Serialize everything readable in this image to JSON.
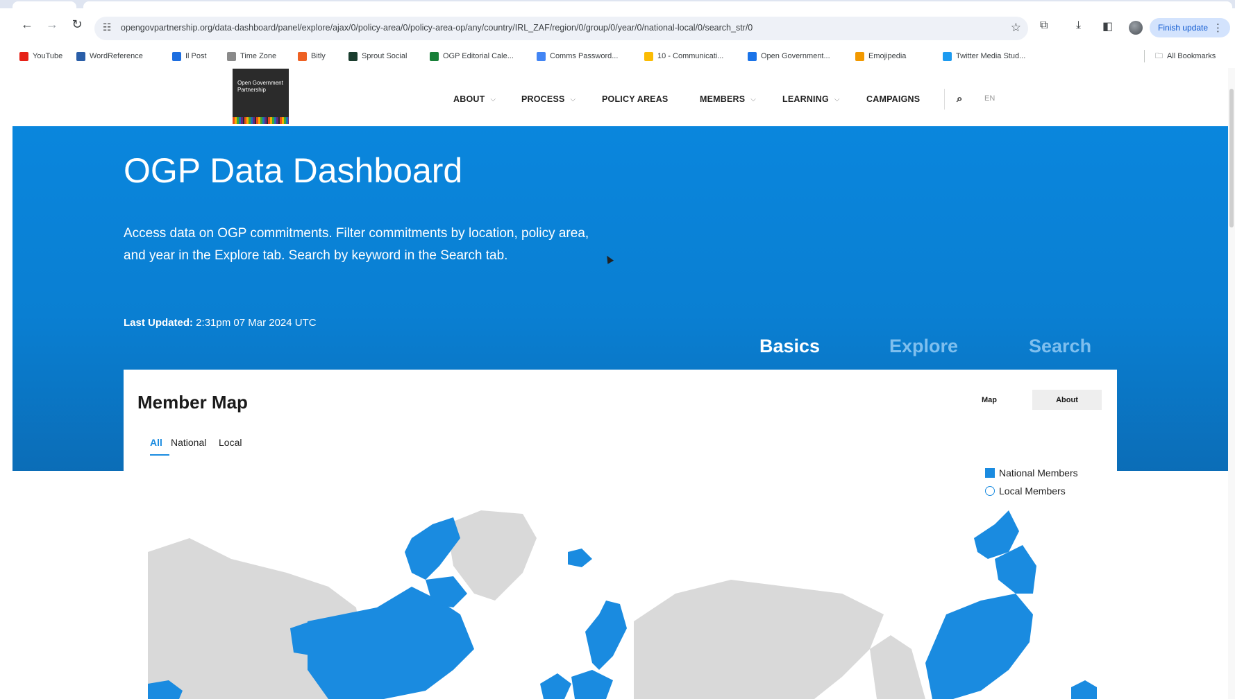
{
  "browser": {
    "url": "opengovpartnership.org/data-dashboard/panel/explore/ajax/0/policy-area/0/policy-area-op/any/country/IRL_ZAF/region/0/group/0/year/0/national-local/0/search_str/0",
    "finish_update_label": "Finish update",
    "bookmarks": [
      {
        "label": "YouTube",
        "color": "#e62117"
      },
      {
        "label": "WordReference",
        "color": "#2a5ea8"
      },
      {
        "label": "Il Post",
        "color": "#1d6ee0"
      },
      {
        "label": "Time Zone",
        "color": "#8a8a8a"
      },
      {
        "label": "Bitly",
        "color": "#ee6123"
      },
      {
        "label": "Sprout Social",
        "color": "#1a3d2e"
      },
      {
        "label": "OGP Editorial Cale...",
        "color": "#188038"
      },
      {
        "label": "Comms Password...",
        "color": "#4285f4"
      },
      {
        "label": "10 - Communicati...",
        "color": "#fbbc04"
      },
      {
        "label": "Open Government...",
        "color": "#1a73e8"
      },
      {
        "label": "Emojipedia",
        "color": "#f29900"
      },
      {
        "label": "Twitter Media Stud...",
        "color": "#1d9bf0"
      }
    ],
    "all_bookmarks_label": "All Bookmarks"
  },
  "site": {
    "logo_text": "Open Government Partnership",
    "nav": [
      "ABOUT",
      "PROCESS",
      "POLICY AREAS",
      "MEMBERS",
      "LEARNING",
      "CAMPAIGNS"
    ],
    "lang": "EN"
  },
  "hero": {
    "title": "OGP Data Dashboard",
    "description": "Access data on OGP commitments. Filter commitments by location, policy area, and year in the Explore tab. Search by keyword in the Search tab.",
    "updated_label": "Last Updated:",
    "updated_value": " 2:31pm 07 Mar 2024 UTC",
    "tabs": [
      "Basics",
      "Explore",
      "Search"
    ]
  },
  "card": {
    "title": "Member Map",
    "view_buttons": [
      "Map",
      "About"
    ],
    "subtabs": [
      "All",
      "National",
      "Local"
    ],
    "legend": [
      "National Members",
      "Local Members"
    ]
  },
  "colors": {
    "accent": "#1a8be0",
    "hero_blue": "#0a84da",
    "map_grey": "#d9d9d9"
  }
}
